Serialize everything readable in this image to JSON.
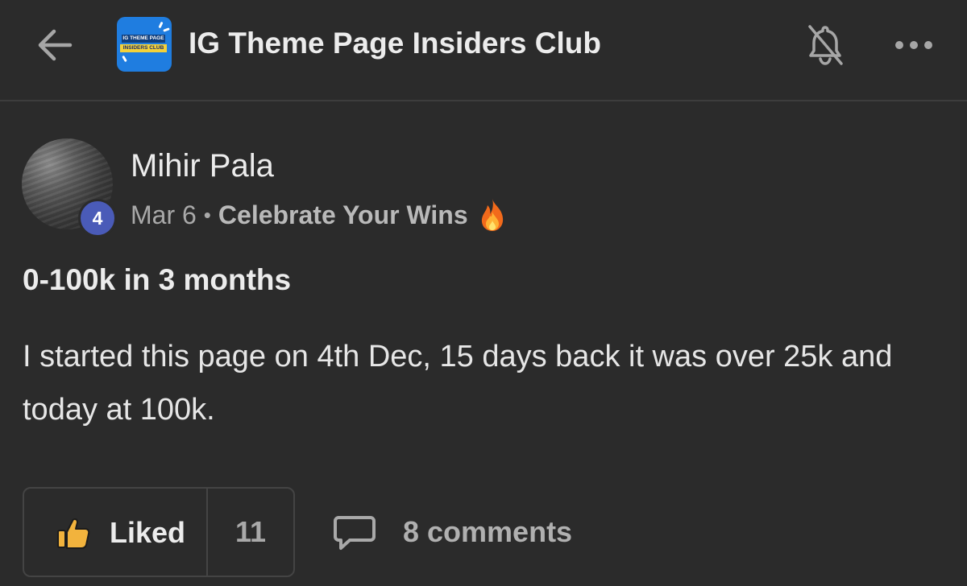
{
  "header": {
    "back_icon": "arrow-left-icon",
    "group_logo": {
      "line1": "IG THEME PAGE",
      "line2": "INSIDERS CLUB",
      "bg_color": "#1f7de0",
      "banner_color": "#f3d13a"
    },
    "title": "IG Theme Page Insiders Club",
    "bell_icon": "bell-muted-icon",
    "more_icon": "more-horizontal-icon"
  },
  "post": {
    "author": {
      "name": "Mihir Pala",
      "level": "4",
      "level_color": "#4a5bb8"
    },
    "date": "Mar 6",
    "separator": "•",
    "category": "Celebrate Your Wins",
    "category_icon": "fire-icon",
    "title": "0-100k in 3 months",
    "body": "I started this page on 4th Dec, 15 days back it was over 25k and today at 100k."
  },
  "actions": {
    "like_icon": "thumbs-up-icon",
    "like_label": "Liked",
    "like_count": "11",
    "comment_icon": "comment-bubble-icon",
    "comments_label": "8 comments"
  },
  "colors": {
    "background": "#2b2b2b",
    "text": "#ececec",
    "muted": "#a9a9a9",
    "like_icon": "#f2b33d"
  }
}
